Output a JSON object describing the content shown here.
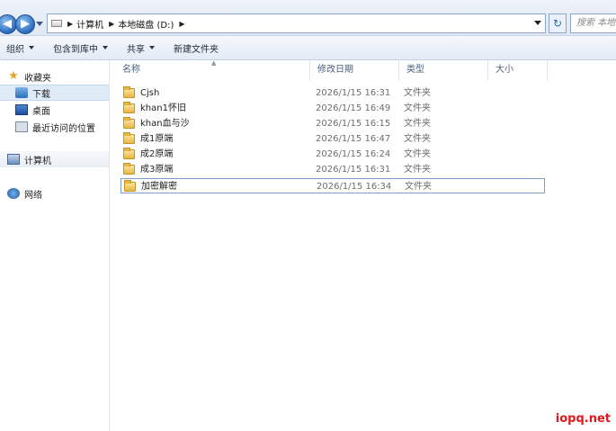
{
  "address": {
    "crumbs": [
      "计算机",
      "本地磁盘 (D:)"
    ],
    "search_placeholder": "搜索 本地磁盘"
  },
  "toolbar": {
    "organize": "组织",
    "include_in_library": "包含到库中",
    "share": "共享",
    "new_folder": "新建文件夹"
  },
  "sidebar": {
    "favorites": "收藏夹",
    "downloads": "下载",
    "desktop": "桌面",
    "recent": "最近访问的位置",
    "computer": "计算机",
    "network": "网络"
  },
  "columns": {
    "name": "名称",
    "modified": "修改日期",
    "type": "类型",
    "size": "大小"
  },
  "files": [
    {
      "name": "Cjsh",
      "date": "2026/1/15 16:31",
      "type": "文件夹"
    },
    {
      "name": "khan1怀旧",
      "date": "2026/1/15 16:49",
      "type": "文件夹"
    },
    {
      "name": "khan血与沙",
      "date": "2026/1/15 16:15",
      "type": "文件夹"
    },
    {
      "name": "成1原端",
      "date": "2026/1/15 16:47",
      "type": "文件夹"
    },
    {
      "name": "成2原端",
      "date": "2026/1/15 16:24",
      "type": "文件夹"
    },
    {
      "name": "成3原端",
      "date": "2026/1/15 16:31",
      "type": "文件夹"
    },
    {
      "name": "加密解密",
      "date": "2026/1/15 16:34",
      "type": "文件夹"
    }
  ],
  "watermark": "iopq.net"
}
